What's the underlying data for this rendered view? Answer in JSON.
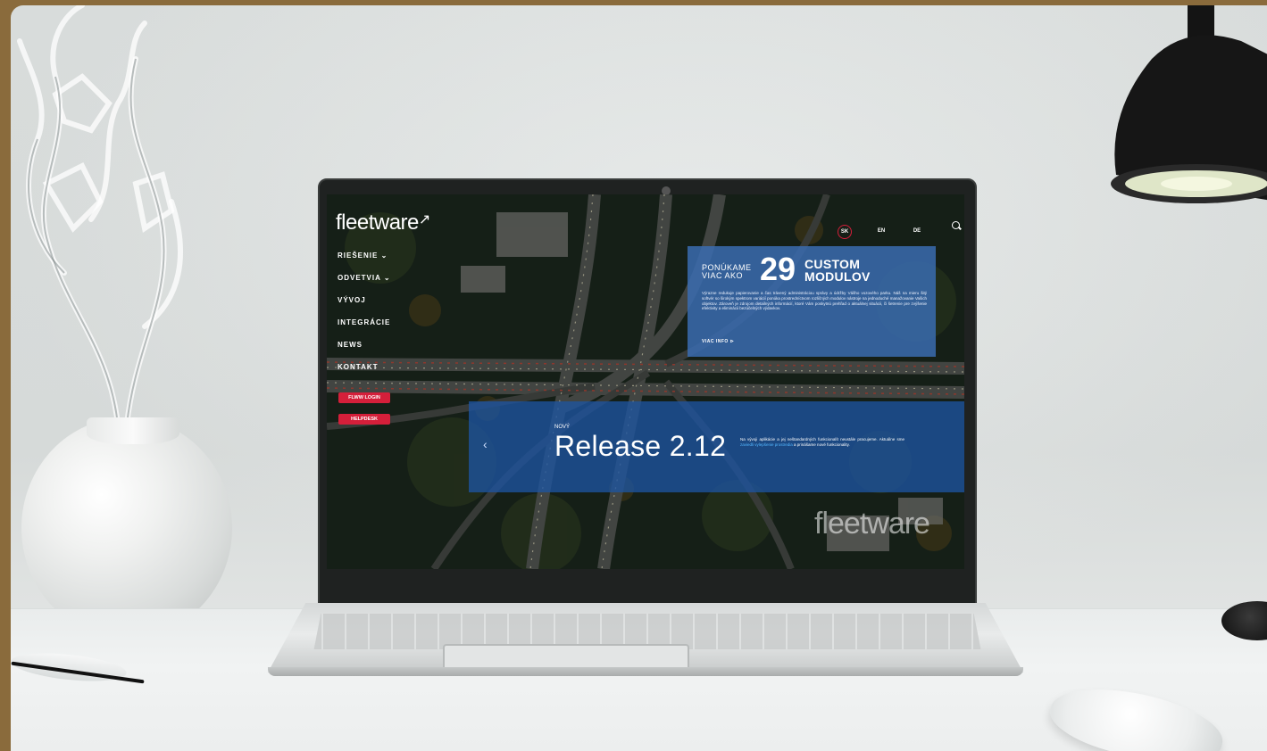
{
  "site": {
    "logo_text": "fleetware",
    "logo_mark": "↗"
  },
  "nav": {
    "items": [
      "RIEŠENIE ⌄",
      "ODVETVIA ⌄",
      "VÝVOJ",
      "INTEGRÁCIE",
      "NEWS",
      "KONTAKT"
    ],
    "login_button": "FLWW LOGIN",
    "helpdesk_button": "HELPDESK"
  },
  "languages": [
    "SK",
    "EN",
    "DE"
  ],
  "active_language": "SK",
  "promo": {
    "pre_line1": "PONÚKAME",
    "pre_line2": "VIAC AKO",
    "number": "29",
    "big_line1": "CUSTOM",
    "big_line2": "MODULOV",
    "body": "Výrazne redukuje papierovanie a čas trávený administráciou správy a údržby Vášho vozového parku. Náš na mieru šitý softvér so širokým spektrom variácií ponúka prostredníctvom rozličných modulov nástroje na jednoduché manažovanie Vašich objektov. Zároveň je zdrojom detailných informácií, ktoré Vám poskytnú prehľad o aktuálnej situácii, či šetrenie pre zvýšenie efektivity a eliminácii bezúčelných výdavkov.",
    "more": "VIAC INFO ⊳"
  },
  "release": {
    "arrow": "‹",
    "badge": "NOVÝ",
    "title": "Release 2.12",
    "desc_before": "Na vývoji aplikácie a jej neštandardných funkcionalít neustále pracujeme. Aktuálne sme",
    "desc_link": "zaviedli vylepšenie prostredia",
    "desc_after": "a prinášame nové funkcionality."
  },
  "watermark": "fleetware",
  "colors": {
    "accent_red": "#d41f3a",
    "promo_blue": "#3a6cb0",
    "release_blue": "#1e54a0",
    "link_blue": "#54b7ff",
    "frame_gold": "#8a6b3c"
  },
  "icons": [
    "search-icon",
    "chevron-left-icon",
    "arrow-right-icon"
  ]
}
